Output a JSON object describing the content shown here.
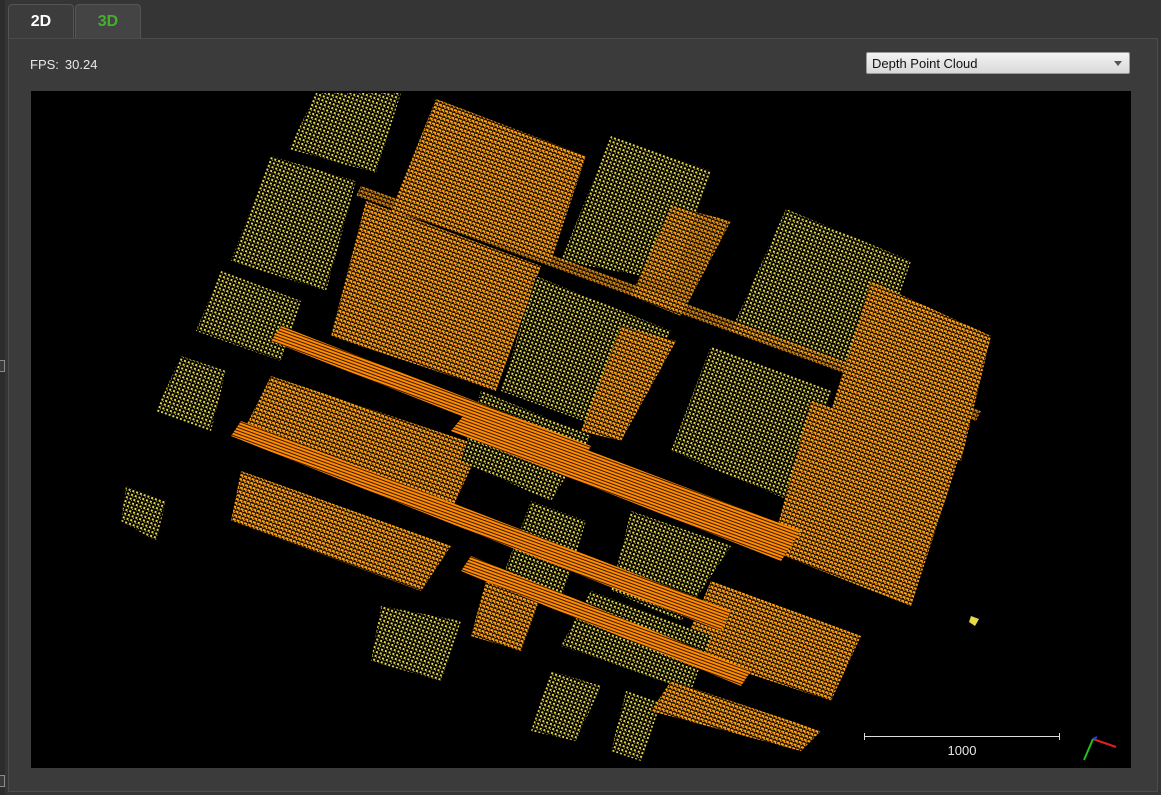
{
  "tabs": [
    {
      "label": "2D",
      "active": false
    },
    {
      "label": "3D",
      "active": true
    }
  ],
  "fps": {
    "label": "FPS:",
    "value": "30.24"
  },
  "view_mode": {
    "selected": "Depth Point Cloud"
  },
  "scale_bar": {
    "label": "1000"
  },
  "colors": {
    "tab_active_text": "#44b02e",
    "point_cloud_near": "#ff8a00",
    "point_cloud_far": "#e8d840",
    "background": "#000000",
    "axis_x": "#e02020",
    "axis_y": "#20c020"
  },
  "icons": {
    "dropdown": "chevron-down-icon",
    "axes": "xyz-axes-icon"
  }
}
